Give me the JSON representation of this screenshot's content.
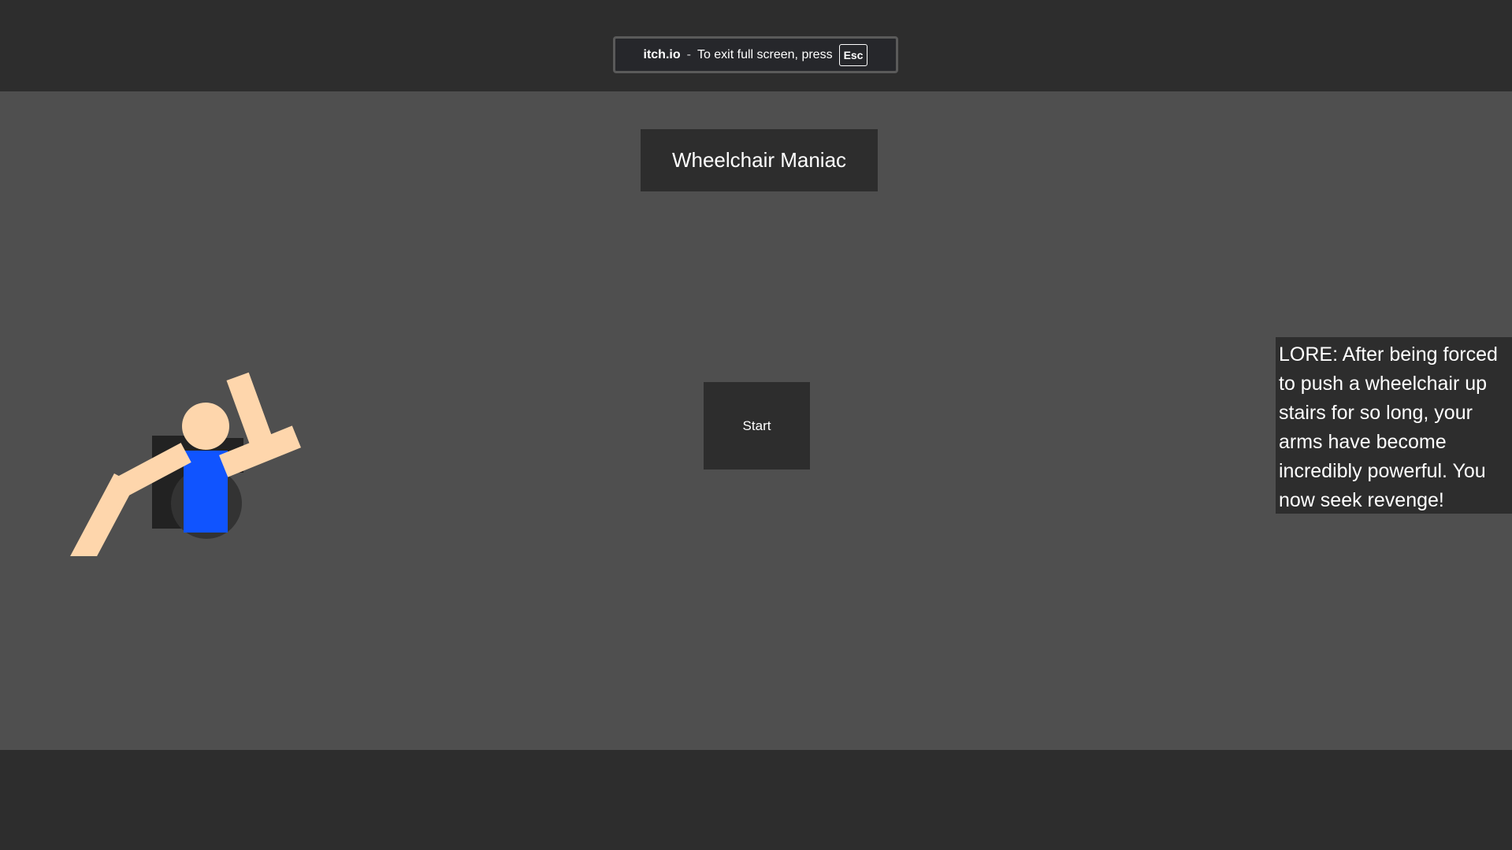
{
  "fullscreen_notice": {
    "brand": "itch.io",
    "separator": "-",
    "message": "To exit full screen, press",
    "key": "Esc"
  },
  "game": {
    "title": "Wheelchair Maniac",
    "start_label": "Start",
    "lore": "LORE: After being forced to push a wheelchair up stairs for so long, your arms have become incredibly powerful. You now seek revenge!"
  },
  "colors": {
    "frame": "#2d2d2d",
    "game_bg": "#4f4f4f",
    "skin": "#fed6ac",
    "shirt": "#1054ff",
    "chair": "#222222",
    "wheel": "#333333"
  },
  "icons": {
    "player": "wheelchair-character"
  }
}
